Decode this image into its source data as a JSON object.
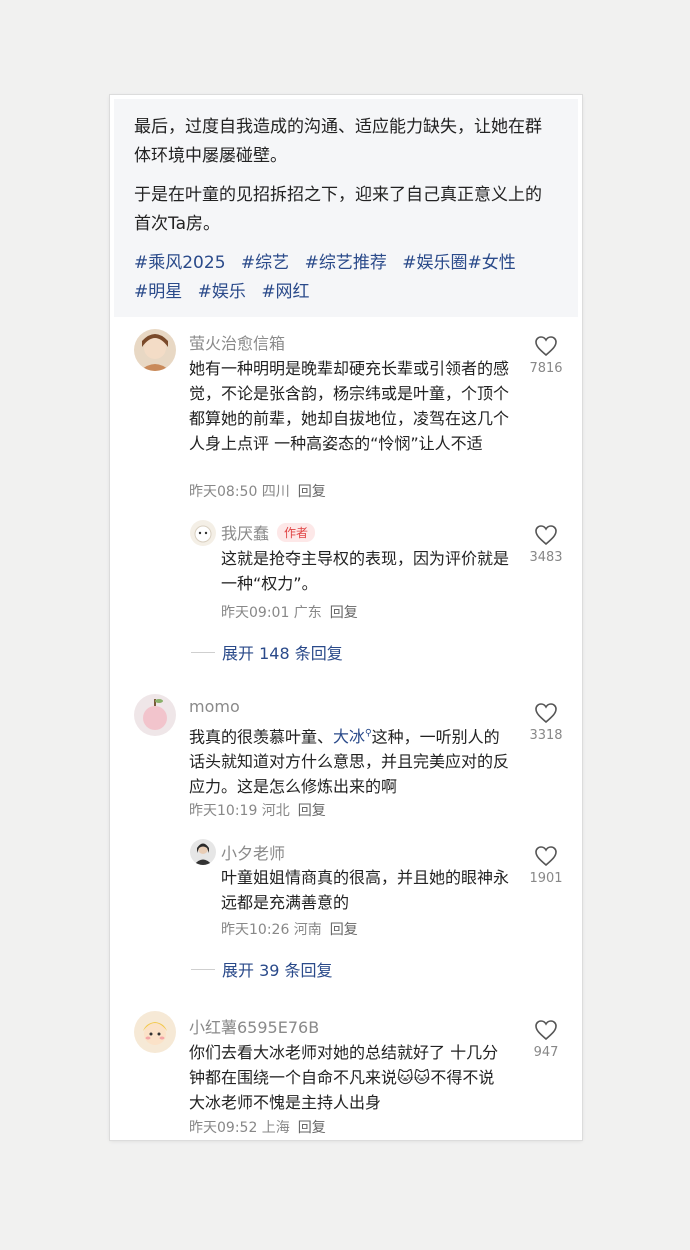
{
  "post": {
    "para1": "最后，过度自我造成的沟通、适应能力缺失，让她在群体环境中屡屡碰壁。",
    "para2": "于是在叶童的见招拆招之下，迎来了自己真正意义上的首次Ta房。",
    "tags": [
      "#乘风2025",
      "#综艺",
      "#综艺推荐",
      "#娱乐圈",
      "#女性",
      "#明星",
      "#娱乐",
      "#网红"
    ]
  },
  "comments": [
    {
      "user": "萤火治愈信箱",
      "text": "她有一种明明是晚辈却硬充长辈或引领者的感觉，不论是张含韵，杨宗纬或是叶童，个顶个都算她的前辈，她却自拔地位，凌驾在这几个人身上点评 一种高姿态的“怜悯”让人不适",
      "time": "昨天08:50 四川",
      "reply_label": "回复",
      "likes": "7816",
      "replies": [
        {
          "user": "我厌蠢",
          "badge": "作者",
          "text": "这就是抢夺主导权的表现，因为评价就是一种“权力”。",
          "time": "昨天09:01 广东",
          "reply_label": "回复",
          "likes": "3483"
        }
      ],
      "expand": "展开 148 条回复"
    },
    {
      "user": "momo",
      "text_before": "我真的很羡慕叶童、",
      "mention": "大冰",
      "text_after": "这种，一听别人的话头就知道对方什么意思，并且完美应对的反应力。这是怎么修炼出来的啊",
      "time": "昨天10:19 河北",
      "reply_label": "回复",
      "likes": "3318",
      "replies": [
        {
          "user": "小夕老师",
          "text": "叶童姐姐情商真的很高，并且她的眼神永远都是充满善意的",
          "time": "昨天10:26 河南",
          "reply_label": "回复",
          "likes": "1901"
        }
      ],
      "expand": "展开 39 条回复"
    },
    {
      "user": "小红薯6595E76B",
      "text": "你们去看大冰老师对她的总结就好了 十几分钟都在围绕一个自命不凡来说🐱🐱不得不说 大冰老师不愧是主持人出身",
      "time": "昨天09:52 上海",
      "reply_label": "回复",
      "likes": "947"
    }
  ],
  "colors": {
    "link": "#2a4a8a",
    "author_badge": "#e04444"
  }
}
